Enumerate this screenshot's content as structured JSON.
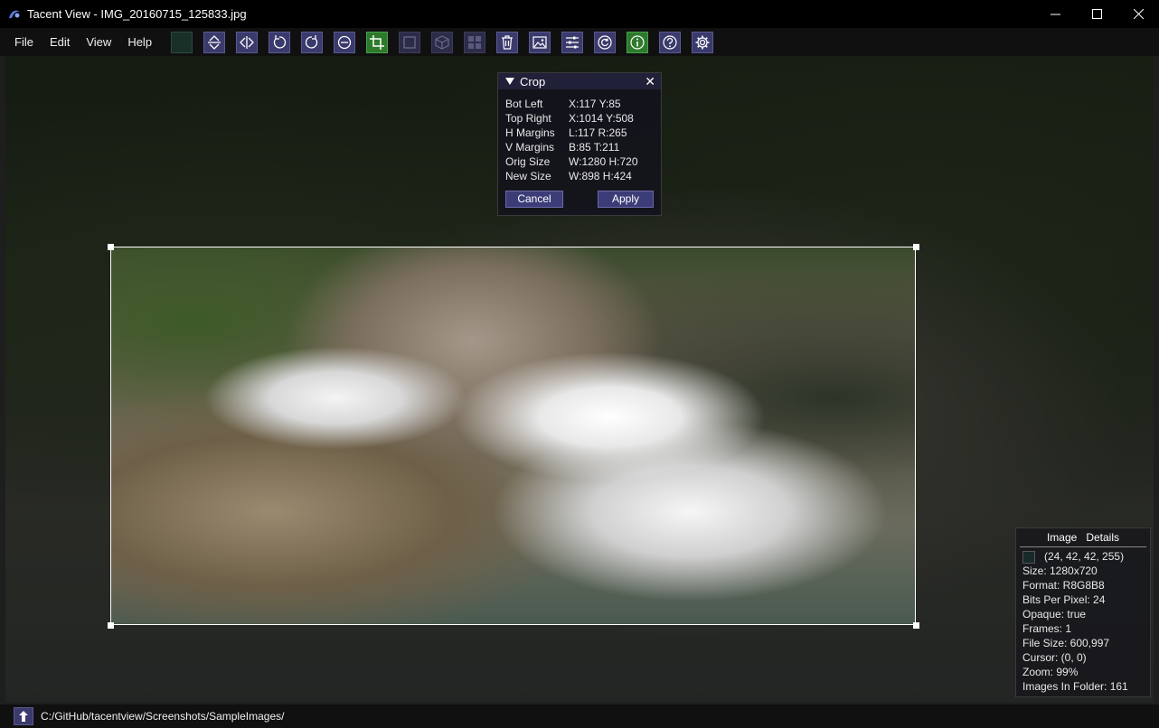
{
  "window": {
    "title": "Tacent View - IMG_20160715_125833.jpg"
  },
  "menu": {
    "items": [
      "File",
      "Edit",
      "View",
      "Help"
    ]
  },
  "toolbar": {
    "buttons": [
      {
        "icon": "color-swatch-icon"
      },
      {
        "icon": "flip-vertical-icon"
      },
      {
        "icon": "flip-horizontal-icon"
      },
      {
        "icon": "rotate-ccw-icon"
      },
      {
        "icon": "rotate-cw-icon"
      },
      {
        "icon": "rotate-theta-icon"
      },
      {
        "icon": "crop-icon",
        "active": true
      },
      {
        "icon": "square-icon"
      },
      {
        "icon": "cube-icon"
      },
      {
        "icon": "grid-icon"
      },
      {
        "icon": "trash-icon"
      },
      {
        "icon": "image-icon"
      },
      {
        "icon": "sliders-icon"
      },
      {
        "icon": "refresh-icon"
      },
      {
        "icon": "info-icon",
        "active": true
      },
      {
        "icon": "help-icon"
      },
      {
        "icon": "gear-icon"
      }
    ]
  },
  "crop": {
    "title": "Crop",
    "rows": [
      {
        "key": "Bot Left",
        "value": "X:117 Y:85"
      },
      {
        "key": "Top Right",
        "value": "X:1014 Y:508"
      },
      {
        "key": "H Margins",
        "value": "L:117 R:265"
      },
      {
        "key": "V Margins",
        "value": "B:85 T:211"
      },
      {
        "key": "Orig Size",
        "value": "W:1280 H:720"
      },
      {
        "key": "New Size",
        "value": "W:898 H:424"
      }
    ],
    "cancel_label": "Cancel",
    "apply_label": "Apply"
  },
  "details": {
    "header": "Image   Details",
    "pixel_color": "(24, 42, 42, 255)",
    "swatch_color": "#182a2a",
    "lines": [
      "Size: 1280x720",
      "Format: R8G8B8",
      "Bits Per Pixel: 24",
      "Opaque: true",
      "Frames: 1",
      "File Size: 600,997",
      "Cursor: (0, 0)",
      "Zoom: 99%",
      "Images In Folder: 161"
    ]
  },
  "status": {
    "path": "C:/GitHub/tacentview/Screenshots/SampleImages/"
  },
  "colors": {
    "accent": "#3a3a6c",
    "active": "#2d7a2d"
  }
}
